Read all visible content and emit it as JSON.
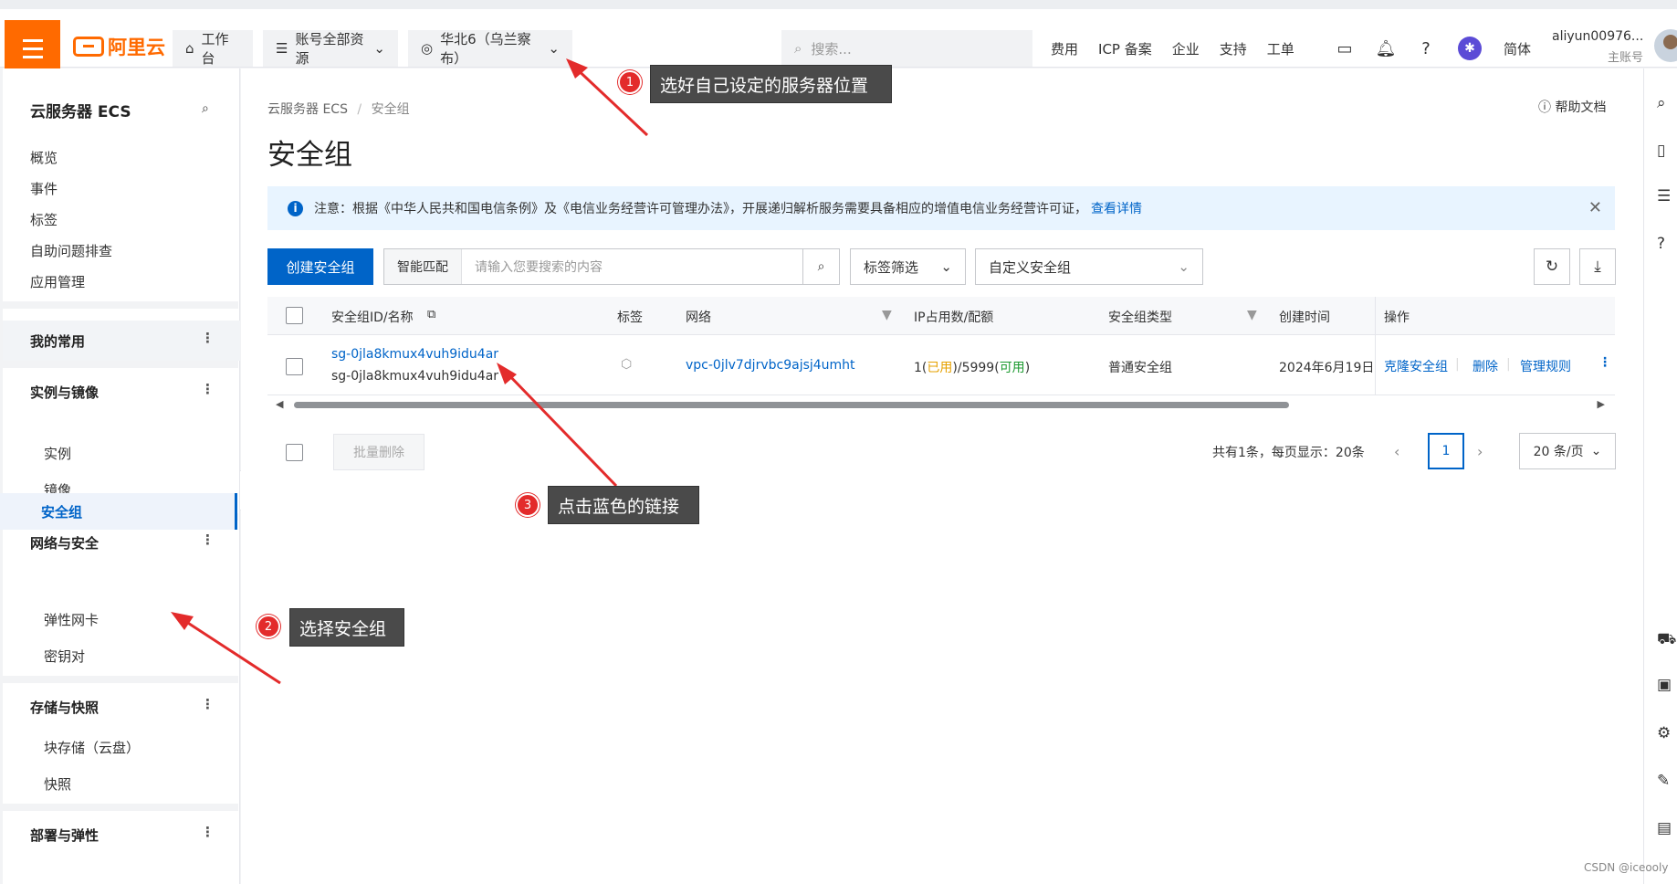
{
  "topbar": {
    "brand": "阿里云",
    "workbench": "工作台",
    "all_resources": "账号全部资源",
    "region": "华北6（乌兰察布）",
    "search_placeholder": "搜索...",
    "links": [
      "费用",
      "ICP 备案",
      "企业",
      "支持",
      "工单"
    ],
    "lang": "简体",
    "username": "aliyun00976...",
    "account_type": "主账号"
  },
  "sidebar": {
    "title": "云服务器 ECS",
    "items": [
      "概览",
      "事件",
      "标签",
      "自助问题排查",
      "应用管理"
    ],
    "groups": {
      "favorites": "我的常用",
      "instances": {
        "label": "实例与镜像",
        "items": [
          "实例",
          "镜像"
        ]
      },
      "network": {
        "label": "网络与安全",
        "items": [
          "安全组",
          "弹性网卡",
          "密钥对"
        ]
      },
      "storage": {
        "label": "存储与快照",
        "items": [
          "块存储（云盘）",
          "快照"
        ]
      },
      "deploy": "部署与弹性"
    }
  },
  "breadcrumb": {
    "root": "云服务器 ECS",
    "sep": "/",
    "current": "安全组"
  },
  "help": "帮助文档",
  "page_title": "安全组",
  "notice": {
    "text": "注意：根据《中华人民共和国电信条例》及《电信业务经营许可管理办法》，开展递归解析服务需要具备相应的增值电信业务经营许可证，",
    "link": "查看详情"
  },
  "toolbar": {
    "create": "创建安全组",
    "match_label": "智能匹配",
    "search_placeholder": "请输入您要搜索的内容",
    "tag_filter": "标签筛选",
    "custom_group": "自定义安全组"
  },
  "table": {
    "headers": [
      "安全组ID/名称",
      "标签",
      "网络",
      "IP占用数/配额",
      "安全组类型",
      "创建时间",
      "操作"
    ],
    "rows": [
      {
        "id": "sg-0jla8kmux4vuh9idu4ar",
        "name": "sg-0jla8kmux4vuh9idu4ar",
        "network": "vpc-0jlv7djrvbc9ajsj4umht",
        "ip_used": "1",
        "ip_used_label": "已用",
        "ip_quota": "5999",
        "ip_quota_label": "可用",
        "type": "普通安全组",
        "created": "2024年6月19日",
        "actions": [
          "克隆安全组",
          "删除",
          "管理规则"
        ]
      }
    ]
  },
  "footer": {
    "batch_delete": "批量删除",
    "total": "共有1条，每页显示：20条",
    "page": "1",
    "page_size": "20 条/页"
  },
  "annotations": [
    {
      "num": "1",
      "text": "选好自己设定的服务器位置"
    },
    {
      "num": "2",
      "text": "选择安全组"
    },
    {
      "num": "3",
      "text": "点击蓝色的链接"
    }
  ],
  "watermark": "CSDN @iceooly",
  "colors": {
    "brand": "#ff6a00",
    "primary": "#0064c8",
    "annotation_arrow": "#e32b2b"
  }
}
